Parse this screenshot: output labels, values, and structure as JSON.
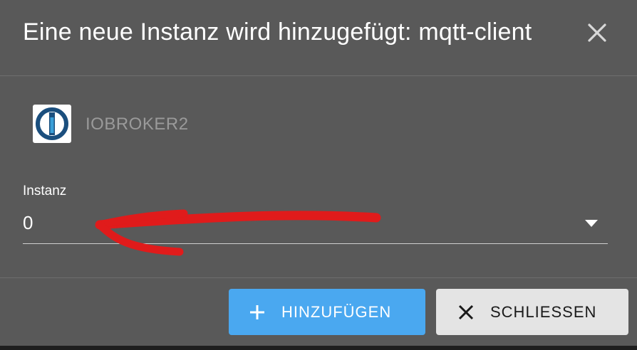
{
  "dialog": {
    "title": "Eine neue Instanz wird hinzugefügt: mqtt-client",
    "close_icon": "close-icon"
  },
  "host": {
    "name": "IOBROKER2",
    "logo_icon": "iobroker-logo-icon"
  },
  "instance_field": {
    "label": "Instanz",
    "value": "0",
    "arrow_icon": "dropdown-arrow-icon"
  },
  "actions": {
    "add_label": "HINZUFÜGEN",
    "add_icon": "plus-icon",
    "close_label": "SCHLIESSEN",
    "close_icon": "close-icon"
  },
  "colors": {
    "dialog_bg": "#595959",
    "primary_button": "#4aa8f0",
    "secondary_button": "#e4e4e4",
    "annotation_arrow": "#e01b1b",
    "logo_blue": "#1b4f7e",
    "logo_accent": "#3a9fd8"
  }
}
